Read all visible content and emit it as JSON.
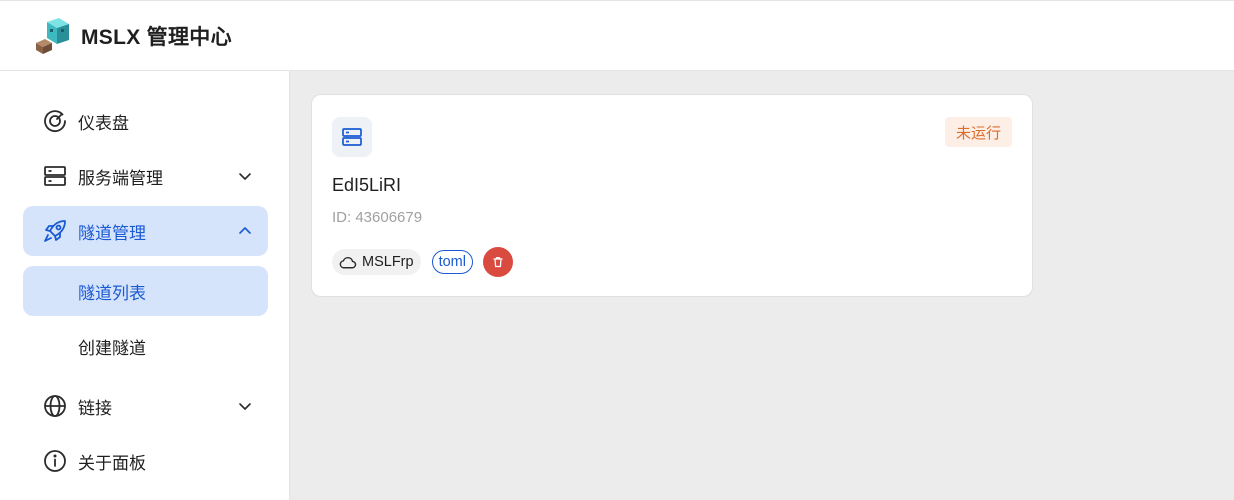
{
  "header": {
    "app_title": "MSLX 管理中心",
    "logo_icon": "minecraft-character-icon"
  },
  "sidebar": {
    "items": [
      {
        "label": "仪表盘",
        "icon": "dashboard-gauge-icon"
      },
      {
        "label": "服务端管理",
        "icon": "server-icon",
        "expandable": true,
        "expanded": false
      },
      {
        "label": "隧道管理",
        "icon": "rocket-icon",
        "expandable": true,
        "expanded": true,
        "active": true
      },
      {
        "label": "隧道列表",
        "sub": true,
        "active": true
      },
      {
        "label": "创建隧道",
        "sub": true
      },
      {
        "label": "链接",
        "icon": "globe-icon",
        "expandable": true,
        "expanded": false
      },
      {
        "label": "关于面板",
        "icon": "info-icon"
      }
    ]
  },
  "tunnel_card": {
    "name": "EdI5LiRI",
    "id_text": "ID: 43606679",
    "status": "未运行",
    "provider": "MSLFrp",
    "format": "toml",
    "icon": "server-icon"
  },
  "colors": {
    "accent": "#1a5ad3",
    "active_bg": "#d6e4fb",
    "status_bg": "#fdeee6",
    "status_text": "#de6d2c",
    "danger": "#d94a3f"
  }
}
